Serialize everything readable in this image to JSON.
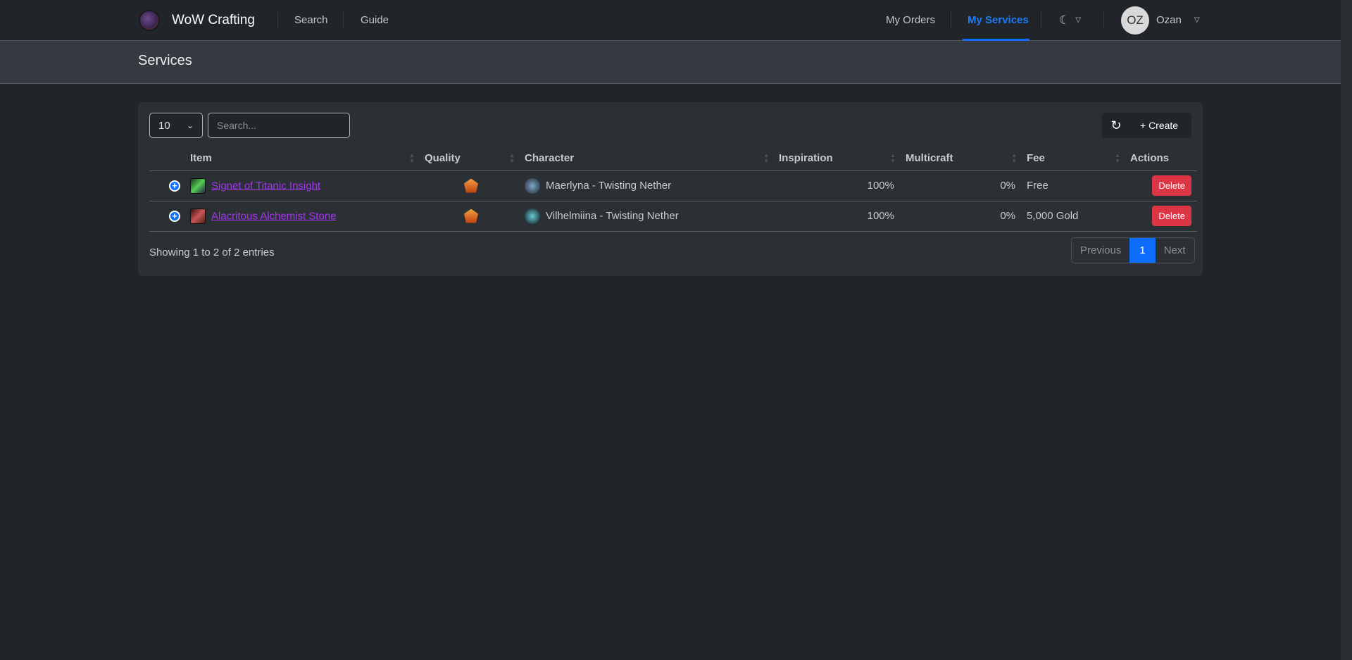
{
  "nav": {
    "brand": "WoW Crafting",
    "links": [
      "Search",
      "Guide"
    ],
    "my_orders": "My Orders",
    "my_services": "My Services",
    "avatar_initials": "OZ",
    "user": "Ozan"
  },
  "page": {
    "title": "Services"
  },
  "toolbar": {
    "page_size": "10",
    "search_placeholder": "Search...",
    "create_label": "+ Create"
  },
  "table": {
    "headers": [
      "Item",
      "Quality",
      "Character",
      "Inspiration",
      "Multicraft",
      "Fee",
      "Actions"
    ],
    "rows": [
      {
        "item": "Signet of Titanic Insight",
        "character": "Maerlyna - Twisting Nether",
        "inspiration": "100%",
        "multicraft": "0%",
        "fee": "Free",
        "action": "Delete"
      },
      {
        "item": "Alacritous Alchemist Stone",
        "character": "Vilhelmiina - Twisting Nether",
        "inspiration": "100%",
        "multicraft": "0%",
        "fee": "5,000 Gold",
        "action": "Delete"
      }
    ]
  },
  "footer": {
    "showing": "Showing 1 to 2 of 2 entries",
    "previous": "Previous",
    "current_page": "1",
    "next": "Next"
  },
  "colors": {
    "accent": "#0d6efd",
    "danger": "#dc3545",
    "item_link": "#a335ee"
  }
}
